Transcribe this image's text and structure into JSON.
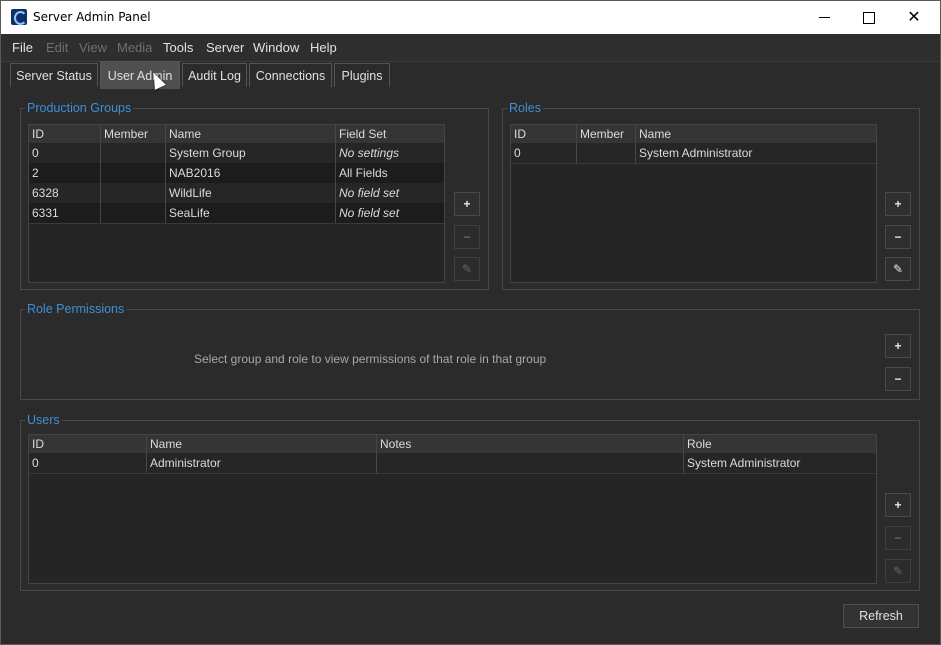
{
  "window": {
    "title": "Server Admin Panel"
  },
  "menu": [
    {
      "label": "File",
      "enabled": true
    },
    {
      "label": "Edit",
      "enabled": false
    },
    {
      "label": "View",
      "enabled": false
    },
    {
      "label": "Media",
      "enabled": false
    },
    {
      "label": "Tools",
      "enabled": true
    },
    {
      "label": "Server",
      "enabled": true
    },
    {
      "label": "Window",
      "enabled": true
    },
    {
      "label": "Help",
      "enabled": true
    }
  ],
  "tabs": [
    {
      "label": "Server Status",
      "active": false
    },
    {
      "label": "User Admin",
      "active": true
    },
    {
      "label": "Audit Log",
      "active": false
    },
    {
      "label": "Connections",
      "active": false
    },
    {
      "label": "Plugins",
      "active": false
    }
  ],
  "production_groups": {
    "title": "Production Groups",
    "columns": [
      "ID",
      "Member",
      "Name",
      "Field Set"
    ],
    "rows": [
      {
        "id": "0",
        "member": "",
        "name": "System Group",
        "field_set": "No settings"
      },
      {
        "id": "2",
        "member": "",
        "name": "NAB2016",
        "field_set": "All Fields"
      },
      {
        "id": "6328",
        "member": "",
        "name": "WildLife",
        "field_set": "No field set"
      },
      {
        "id": "6331",
        "member": "",
        "name": "SeaLife",
        "field_set": "No field set"
      }
    ]
  },
  "roles": {
    "title": "Roles",
    "columns": [
      "ID",
      "Member",
      "Name"
    ],
    "rows": [
      {
        "id": "0",
        "member": "",
        "name": "System Administrator"
      }
    ]
  },
  "role_permissions": {
    "title": "Role Permissions",
    "hint": "Select group and role to view permissions of that role in that group"
  },
  "users": {
    "title": "Users",
    "columns": [
      "ID",
      "Name",
      "Notes",
      "Role"
    ],
    "rows": [
      {
        "id": "0",
        "name": "Administrator",
        "notes": "",
        "role": "System Administrator"
      }
    ]
  },
  "buttons": {
    "add": "+",
    "remove": "−",
    "edit": "✎",
    "refresh": "Refresh"
  }
}
